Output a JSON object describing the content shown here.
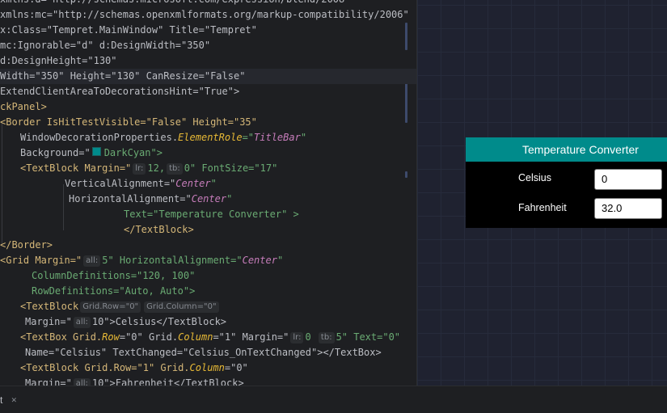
{
  "editor": {
    "lines": [
      [
        "xmlns:d=\"http://schemas.microsoft.com/expression/blend/2008\""
      ],
      [
        "xmlns:mc=\"http://schemas.openxmlformats.org/markup-compatibility/2006\""
      ],
      [
        "x:Class=\"Tempret.MainWindow\" Title=\"Tempret\""
      ],
      [
        "mc:Ignorable=\"d\" d:DesignWidth=\"350\""
      ],
      [
        "d:DesignHeight=\"130\""
      ],
      [
        "Width=\"350\" Height=\"130\" CanResize=\"False\""
      ],
      [
        "ExtendClientAreaToDecorationsHint=\"True\">"
      ],
      [
        "ckPanel>"
      ],
      [
        "<Border IsHitTestVisible=\"False\" Height=\"35\""
      ],
      [
        "WindowDecorationProperties.",
        "ElementRole",
        "=\"",
        "TitleBar",
        "\""
      ],
      [
        "Background=\"",
        "DarkCyan",
        "\">"
      ],
      [
        "<TextBlock Margin=\"",
        "lr:",
        "12,",
        "tb:",
        "0\" FontSize=\"17\""
      ],
      [
        "VerticalAlignment=\"",
        "Center",
        "\""
      ],
      [
        "HorizontalAlignment=\"",
        "Center",
        "\""
      ],
      [
        "Text=\"Temperature Converter\" >"
      ],
      [
        "</TextBlock>"
      ],
      [
        "</Border>"
      ],
      [
        "<Grid Margin=\"",
        "all:",
        "5\" HorizontalAlignment=\"",
        "Center",
        "\""
      ],
      [
        "ColumnDefinitions=\"120, 100\""
      ],
      [
        "RowDefinitions=\"Auto, Auto\">"
      ],
      [
        "<TextBlock",
        "Grid.Row=\"0\"",
        "Grid.Column=\"0\""
      ],
      [
        "Margin=\"",
        "all:",
        "10\">Celsius</TextBlock>"
      ],
      [
        "<TextBox Grid.",
        "Row",
        "=\"0\" Grid.",
        "Column",
        "=\"1\" Margin=\"",
        "lr:",
        "0 ",
        "tb:",
        "5\" Text=\"0\""
      ],
      [
        "Name=\"Celsius\" TextChanged=\"Celsius_OnTextChanged\"></TextBox>"
      ],
      [
        "<TextBlock Grid.Row=\"1\" Grid.",
        "Column",
        "=\"0\""
      ],
      [
        "Margin=\"",
        "all:",
        "10\">Fahrenheit</TextBlock>"
      ]
    ]
  },
  "preview": {
    "window_title": "Temperature Converter",
    "title_color": "#008B8B",
    "rows": [
      {
        "label": "Celsius",
        "value": "0"
      },
      {
        "label": "Fahrenheit",
        "value": "32.0"
      }
    ]
  },
  "statusbar": {
    "tab_label": "t",
    "close_icon": "close-icon"
  }
}
